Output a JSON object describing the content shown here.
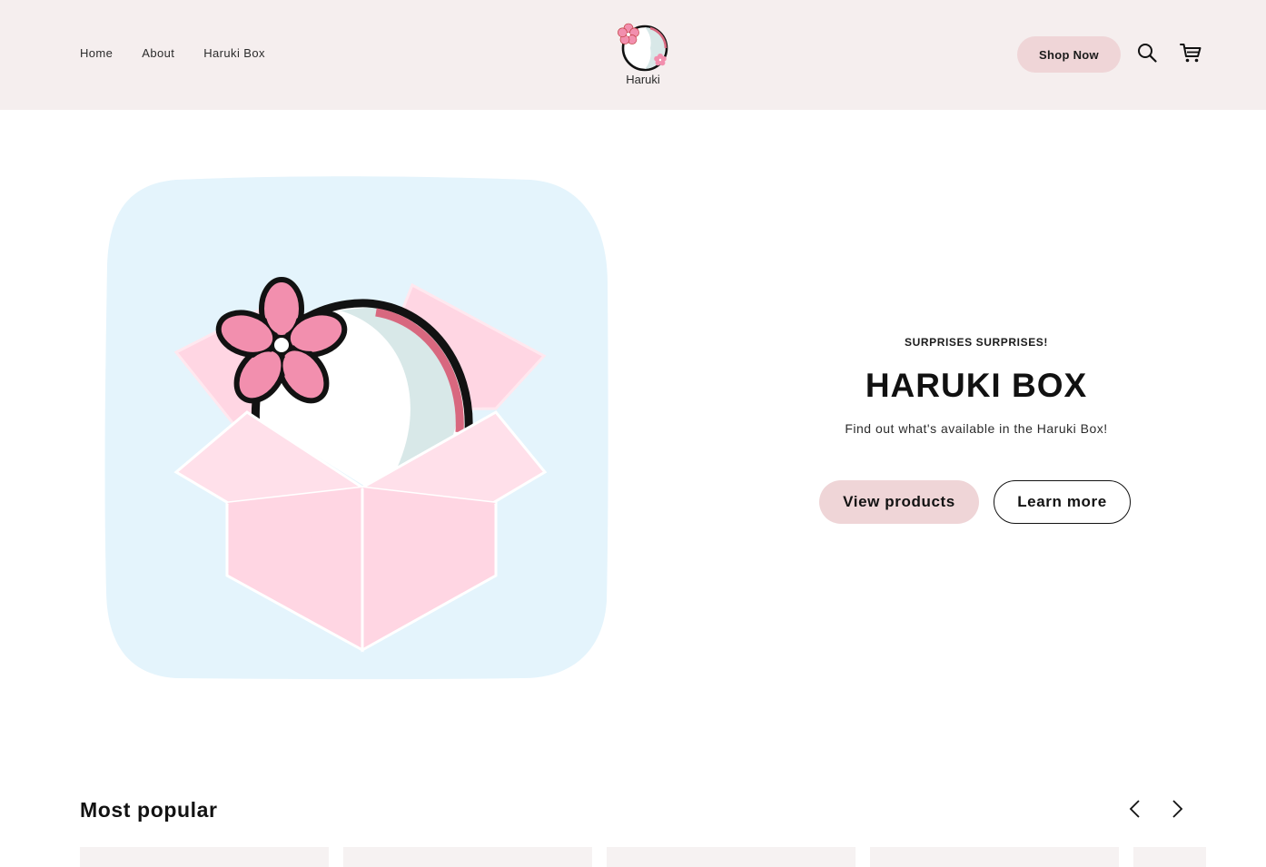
{
  "header": {
    "nav": [
      "Home",
      "About",
      "Haruki Box"
    ],
    "logo_text": "Haruki",
    "shop_label": "Shop Now",
    "icons": [
      "search-icon",
      "cart-icon"
    ]
  },
  "hero": {
    "eyebrow": "SURPRISES SURPRISES!",
    "title": "HARUKI BOX",
    "description": "Find out what's available in the Haruki Box!",
    "primary_button": "View products",
    "secondary_button": "Learn more"
  },
  "popular": {
    "title": "Most popular",
    "icons": [
      "chevron-left-icon",
      "chevron-right-icon"
    ]
  },
  "colors": {
    "header_bg": "#f5eeee",
    "button_pink": "#efd5d7",
    "hero_bg": "#e4f4fc",
    "box_pink": "#ffd6e3",
    "flower_pink": "#f28fae"
  }
}
